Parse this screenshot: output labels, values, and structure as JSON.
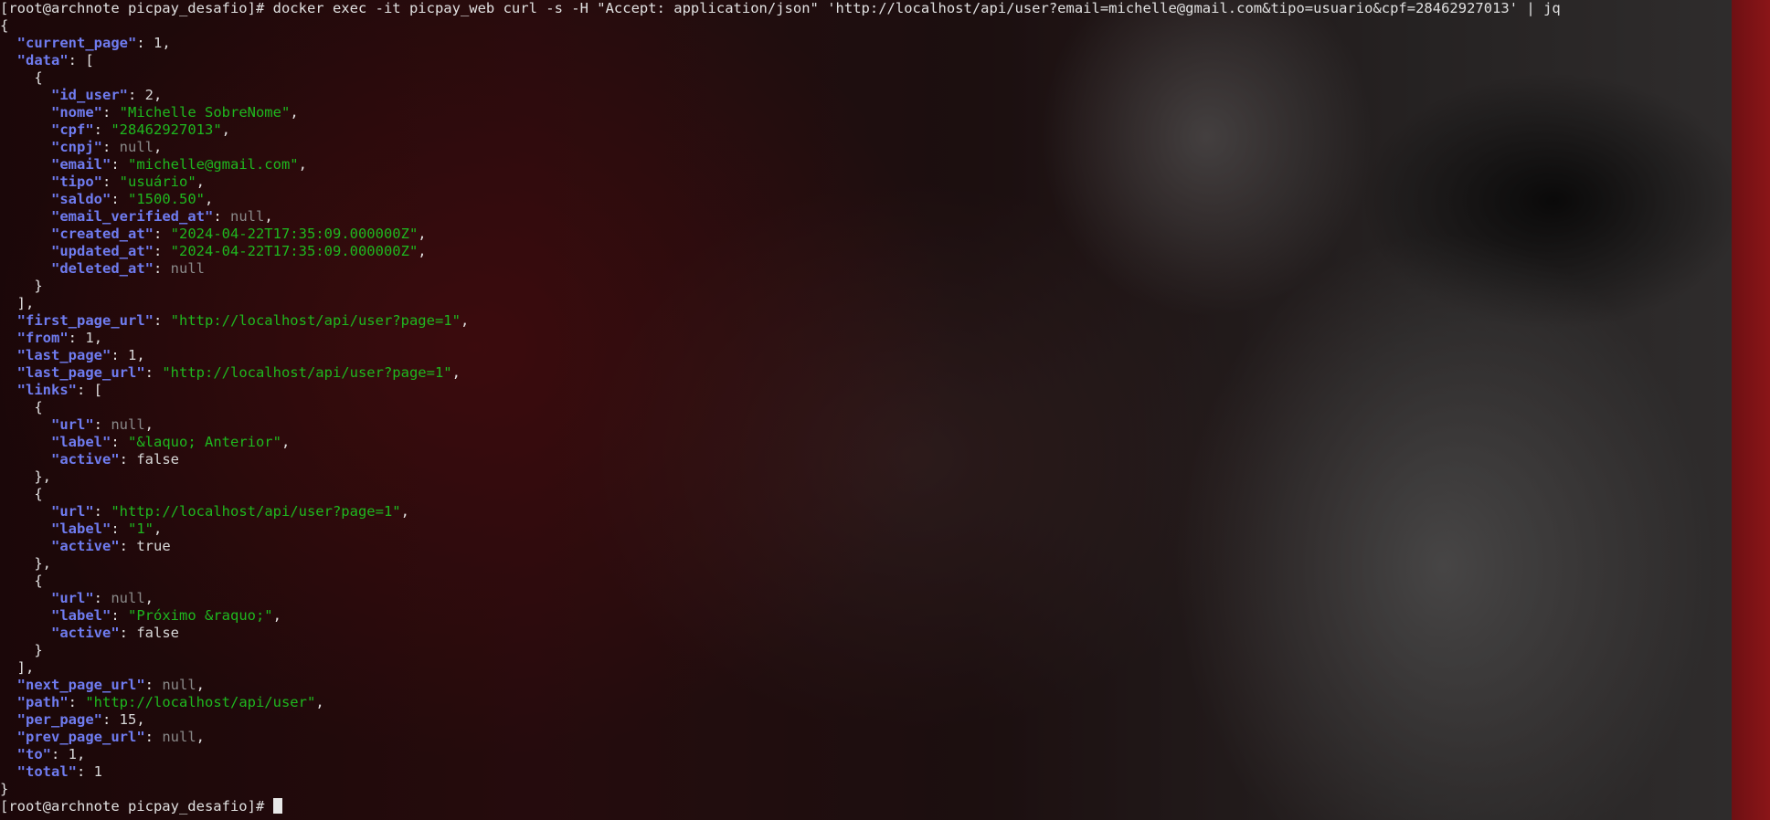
{
  "terminal": {
    "prompt": "[root@archnote picpay_desafio]#",
    "command": "docker exec -it picpay_web curl -s -H \"Accept: application/json\" 'http://localhost/api/user?email=michelle@gmail.com&tipo=usuario&cpf=28462927013' | jq",
    "final_prompt": "[root@archnote picpay_desafio]#"
  },
  "json": {
    "current_page": "1",
    "data": [
      {
        "id_user": "2",
        "nome": "\"Michelle SobreNome\"",
        "cpf": "\"28462927013\"",
        "cnpj": "null",
        "email": "\"michelle@gmail.com\"",
        "tipo": "\"usuário\"",
        "saldo": "\"1500.50\"",
        "email_verified_at": "null",
        "created_at": "\"2024-04-22T17:35:09.000000Z\"",
        "updated_at": "\"2024-04-22T17:35:09.000000Z\"",
        "deleted_at": "null"
      }
    ],
    "first_page_url": "\"http://localhost/api/user?page=1\"",
    "from": "1",
    "last_page": "1",
    "last_page_url": "\"http://localhost/api/user?page=1\"",
    "links": [
      {
        "url": "null",
        "label": "\"&laquo; Anterior\"",
        "active": "false"
      },
      {
        "url": "\"http://localhost/api/user?page=1\"",
        "label": "\"1\"",
        "active": "true"
      },
      {
        "url": "null",
        "label": "\"Próximo &raquo;\"",
        "active": "false"
      }
    ],
    "next_page_url": "null",
    "path": "\"http://localhost/api/user\"",
    "per_page": "15",
    "prev_page_url": "null",
    "to": "1",
    "total": "1"
  },
  "keys": {
    "current_page": "\"current_page\"",
    "data": "\"data\"",
    "id_user": "\"id_user\"",
    "nome": "\"nome\"",
    "cpf": "\"cpf\"",
    "cnpj": "\"cnpj\"",
    "email": "\"email\"",
    "tipo": "\"tipo\"",
    "saldo": "\"saldo\"",
    "email_verified_at": "\"email_verified_at\"",
    "created_at": "\"created_at\"",
    "updated_at": "\"updated_at\"",
    "deleted_at": "\"deleted_at\"",
    "first_page_url": "\"first_page_url\"",
    "from": "\"from\"",
    "last_page": "\"last_page\"",
    "last_page_url": "\"last_page_url\"",
    "links": "\"links\"",
    "url": "\"url\"",
    "label": "\"label\"",
    "active": "\"active\"",
    "next_page_url": "\"next_page_url\"",
    "path": "\"path\"",
    "per_page": "\"per_page\"",
    "prev_page_url": "\"prev_page_url\"",
    "to": "\"to\"",
    "total": "\"total\""
  },
  "colors": {
    "key": "#6f7cf0",
    "string": "#1fb81f",
    "null": "#8a8a8a",
    "text": "#d3d3d3",
    "wallpaper_edge": "#8a1518"
  }
}
